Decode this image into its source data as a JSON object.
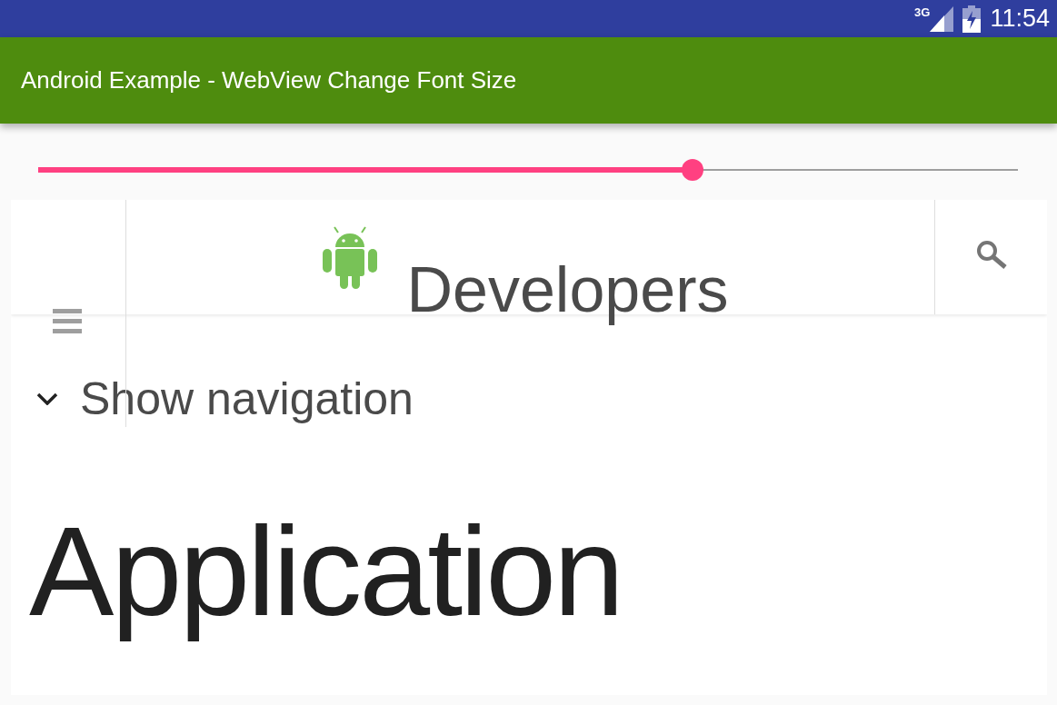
{
  "status_bar": {
    "network": "3G",
    "time": "11:54"
  },
  "app_bar": {
    "title": "Android Example - WebView Change Font Size"
  },
  "font_slider": {
    "level": 0.668
  },
  "webview": {
    "brand": "Developers",
    "nav_toggle": {
      "label": "Show navigation",
      "expanded": false
    },
    "heading": "Application"
  }
}
